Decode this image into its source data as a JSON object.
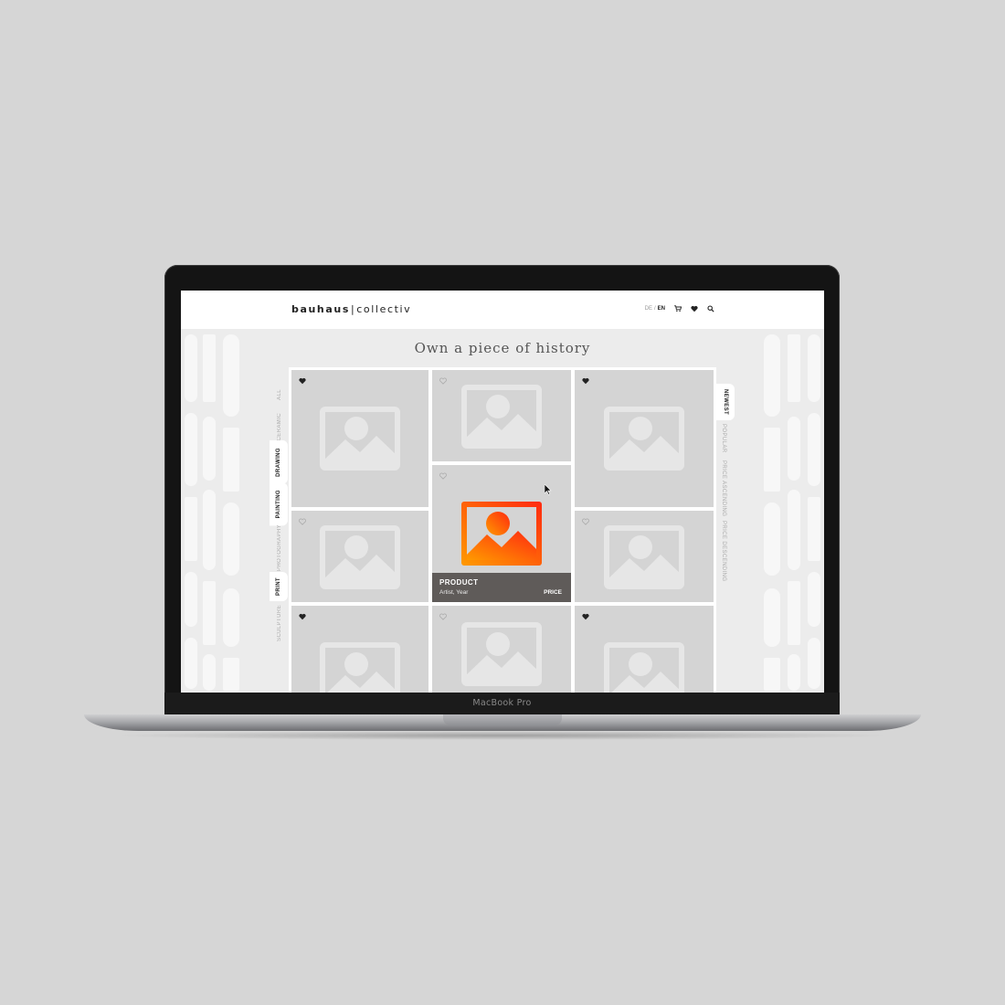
{
  "device": {
    "label": "MacBook Pro"
  },
  "site": {
    "logo_main": "bauhaus",
    "logo_sep": "|",
    "logo_sub": "collectiv",
    "lang_de": "DE",
    "lang_sep": "/",
    "lang_en": "EN",
    "icons": [
      "cart-icon",
      "heart-icon",
      "search-icon"
    ]
  },
  "heading": "Own a piece of history",
  "categories": [
    "ALL",
    "CERAMIC",
    "DRAWING",
    "PAINTING",
    "PHOTOGRAPHY",
    "PRINT",
    "SCULPTURE"
  ],
  "categories_active": [
    "DRAWING",
    "PAINTING",
    "PRINT"
  ],
  "sort_options": [
    "NEWEST",
    "POPULAR",
    "PRICE ASCENDING",
    "PRICE DESCENDING"
  ],
  "sort_active": "NEWEST",
  "product_card": {
    "name": "PRODUCT",
    "artist_year": "Artist, Year",
    "price": "PRICE"
  },
  "colors": {
    "accent_gradient_start": "#ff9a00",
    "accent_gradient_end": "#ff2a10",
    "caption_bg": "#5f5b59",
    "tile_bg": "#d4d4d4"
  }
}
